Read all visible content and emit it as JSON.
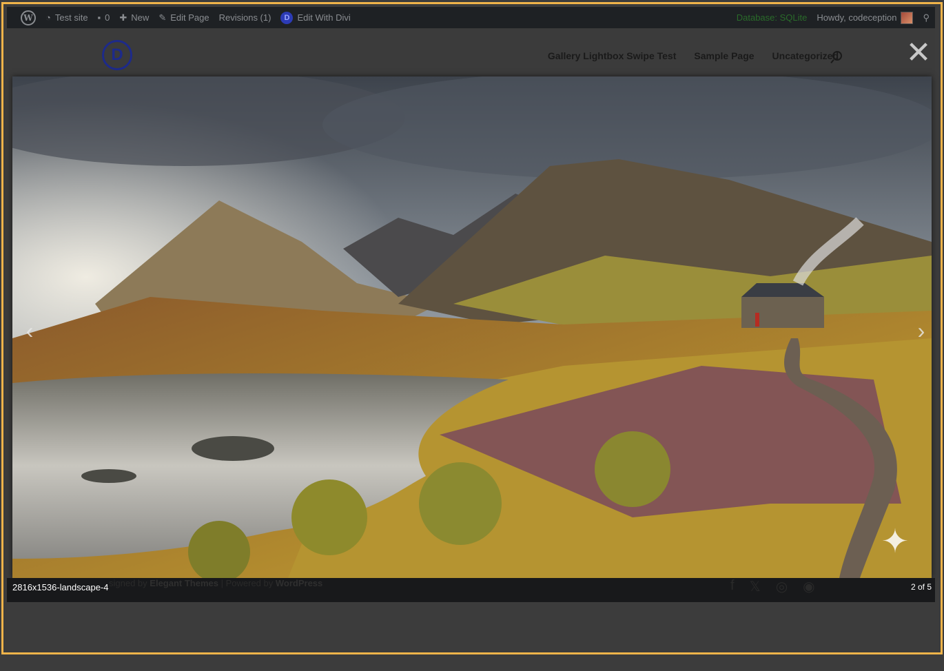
{
  "admin_bar": {
    "site_name": "Test site",
    "comments_count": "0",
    "new_label": "New",
    "edit_page_label": "Edit Page",
    "revisions_label": "Revisions (1)",
    "edit_divi_label": "Edit With Divi",
    "database_label": "Database: SQLite",
    "howdy_label": "Howdy, codeception"
  },
  "header": {
    "logo_letter": "D",
    "nav": [
      "Gallery Lightbox Swipe Test",
      "Sample Page",
      "Uncategorized"
    ]
  },
  "lightbox": {
    "close_symbol": "✕",
    "prev_symbol": "‹",
    "next_symbol": "›",
    "caption": "2816x1536-landscape-4",
    "counter": "2 of 5",
    "sparkle_symbol": "✦"
  },
  "footer": {
    "credit_prefix": "signed by",
    "credit_brand": "Elegant Themes",
    "credit_mid": "| Powered by",
    "credit_wp": "WordPress"
  },
  "icons": [
    "wordpress-icon",
    "dashboard-icon",
    "comment-icon",
    "plus-icon",
    "pencil-icon",
    "divi-icon",
    "search-icon",
    "close-icon",
    "chevron-left-icon",
    "chevron-right-icon",
    "facebook-icon",
    "x-icon",
    "instagram-icon",
    "rss-icon"
  ],
  "colors": {
    "accent_border": "#f0b44a",
    "admin_bar_bg": "#1e2124",
    "overlay_bg": "#3c3c3c",
    "logo_blue": "#1d2a8a"
  }
}
